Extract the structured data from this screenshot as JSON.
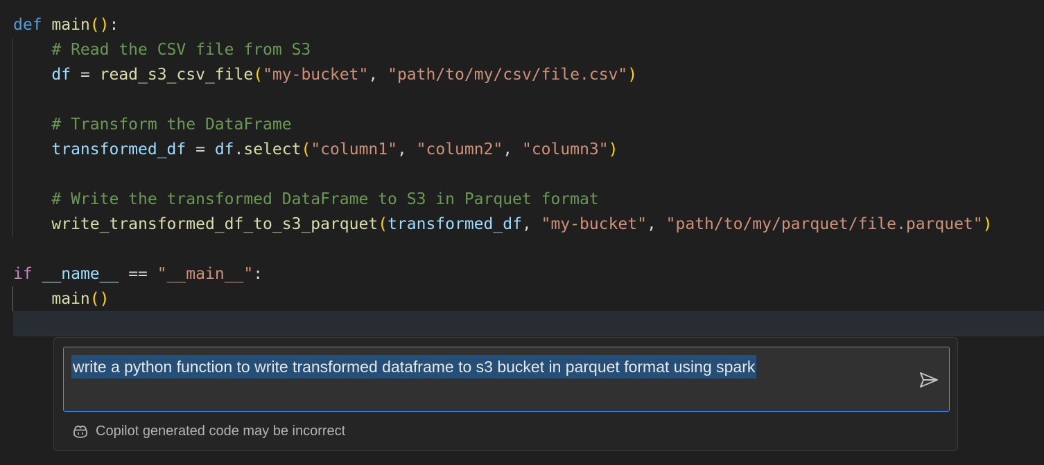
{
  "code": {
    "line1": {
      "kw": "def",
      "fn": "main",
      "open": "(",
      "close": ")",
      "colon": ":"
    },
    "line2": {
      "comment": "# Read the CSV file from S3"
    },
    "line3": {
      "var": "df",
      "eq": " = ",
      "fn": "read_s3_csv_file",
      "open": "(",
      "arg1": "\"my-bucket\"",
      "sep": ", ",
      "arg2": "\"path/to/my/csv/file.csv\"",
      "close": ")"
    },
    "line5": {
      "comment": "# Transform the DataFrame"
    },
    "line6": {
      "var": "transformed_df",
      "eq": " = ",
      "obj": "df",
      "dot": ".",
      "fn": "select",
      "open": "(",
      "arg1": "\"column1\"",
      "sep1": ", ",
      "arg2": "\"column2\"",
      "sep2": ", ",
      "arg3": "\"column3\"",
      "close": ")"
    },
    "line8": {
      "comment": "# Write the transformed DataFrame to S3 in Parquet format"
    },
    "line9": {
      "fn": "write_transformed_df_to_s3_parquet",
      "open": "(",
      "arg0": "transformed_df",
      "sep1": ", ",
      "arg1": "\"my-bucket\"",
      "sep2": ", ",
      "arg2": "\"path/to/my/parquet/file.parquet\"",
      "close": ")"
    },
    "line11": {
      "kw": "if",
      "var": "__name__",
      "op": " == ",
      "str": "\"__main__\"",
      "colon": ":"
    },
    "line12": {
      "fn": "main",
      "open": "(",
      "close": ")"
    }
  },
  "inline_chat": {
    "prompt": "write a python function to write transformed dataframe to s3 bucket in parquet format using spark",
    "send_icon": "send-icon",
    "disclaimer": "Copilot generated code may be incorrect",
    "disclaimer_icon": "copilot-icon"
  },
  "colors": {
    "background": "#1f1f1f",
    "accent_border": "#3794ff",
    "selection": "#264f78"
  }
}
